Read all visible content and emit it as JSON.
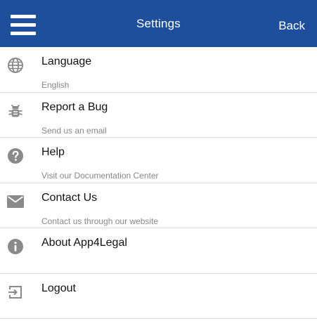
{
  "header": {
    "title": "Settings",
    "back_label": "Back"
  },
  "items": [
    {
      "label": "Language",
      "sub": "English"
    },
    {
      "label": "Report a Bug",
      "sub": "Send us an email"
    },
    {
      "label": "Help",
      "sub": "Visit our Documentation Center"
    },
    {
      "label": "Contact Us",
      "sub": "Contact us through our website"
    },
    {
      "label": "About App4Legal",
      "sub": ""
    },
    {
      "label": "Logout",
      "sub": ""
    }
  ],
  "colors": {
    "header_bg": "#1d4f9c",
    "icon": "#8a8a8a",
    "divider": "#dedede"
  }
}
